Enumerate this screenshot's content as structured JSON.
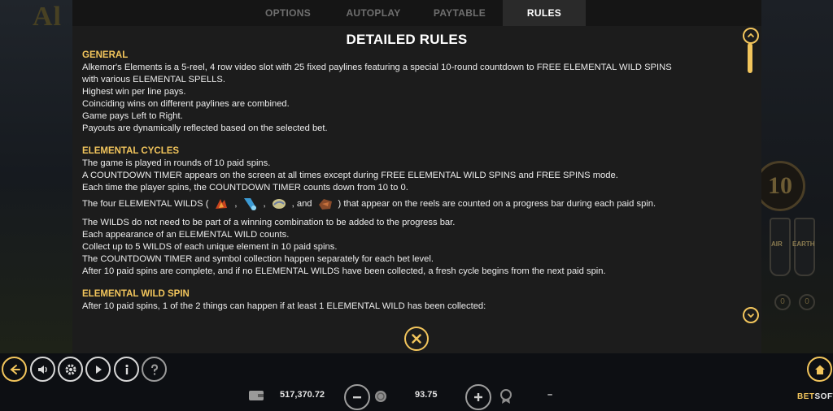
{
  "tabs": [
    {
      "label": "OPTIONS",
      "active": false
    },
    {
      "label": "AUTOPLAY",
      "active": false
    },
    {
      "label": "PAYTABLE",
      "active": false
    },
    {
      "label": "RULES",
      "active": true
    }
  ],
  "rules": {
    "title": "DETAILED RULES",
    "general": {
      "title": "GENERAL",
      "lines": [
        "Alkemor's Elements is a 5-reel, 4 row video slot with 25 fixed paylines featuring a special 10-round countdown to FREE ELEMENTAL WILD SPINS",
        "with various ELEMENTAL SPELLS.",
        "Highest win per line pays.",
        "Coinciding wins on different paylines are combined.",
        "Game pays Left to Right.",
        "Payouts are dynamically reflected based on the selected bet."
      ]
    },
    "cycles": {
      "title": "ELEMENTAL CYCLES",
      "lines": [
        "The game is played in rounds of 10 paid spins.",
        "A COUNTDOWN TIMER appears on the screen at all times except during FREE ELEMENTAL WILD SPINS and FREE SPINS mode.",
        "Each time the player spins, the COUNTDOWN TIMER counts down from 10 to 0."
      ],
      "wilds_prefix": "The four ELEMENTAL WILDS (",
      "wilds_sep1": ",",
      "wilds_sep2": ",",
      "wilds_sep3": ", and",
      "wilds_suffix": ") that appear on the reels are counted on a progress bar during each paid spin.",
      "lines2": [
        "The WILDS do not need to be part of a winning combination to be added to the progress bar.",
        "Each appearance of an ELEMENTAL WILD counts.",
        "Collect up to 5 WILDS of each unique element in 10 paid spins.",
        "The COUNTDOWN TIMER and symbol collection happen separately for each bet level.",
        "After 10 paid spins are complete, and if no ELEMENTAL WILDS have been collected, a fresh cycle begins from the next paid spin."
      ]
    },
    "wild_spin": {
      "title": "ELEMENTAL WILD SPIN",
      "lines": [
        "After 10 paid spins, 1 of the 2 things can happen if at least 1 ELEMENTAL WILD has been collected:"
      ]
    }
  },
  "wild_icons": [
    "fire-wild-icon",
    "water-wild-icon",
    "air-wild-icon",
    "earth-wild-icon"
  ],
  "bottom": {
    "balance": "517,370.72",
    "bet": "93.75",
    "win": "–",
    "brand_a": "BET",
    "brand_b": "SOFT"
  },
  "background": {
    "logo_text": "Al",
    "counter": "10",
    "vial_labels": [
      "AIR",
      "EARTH"
    ],
    "dots": [
      "0",
      "0"
    ]
  },
  "colors": {
    "accent": "#f2c55c",
    "panel": "#1c1c1c",
    "tab_active": "#2a2a2a",
    "text": "#ececec"
  }
}
